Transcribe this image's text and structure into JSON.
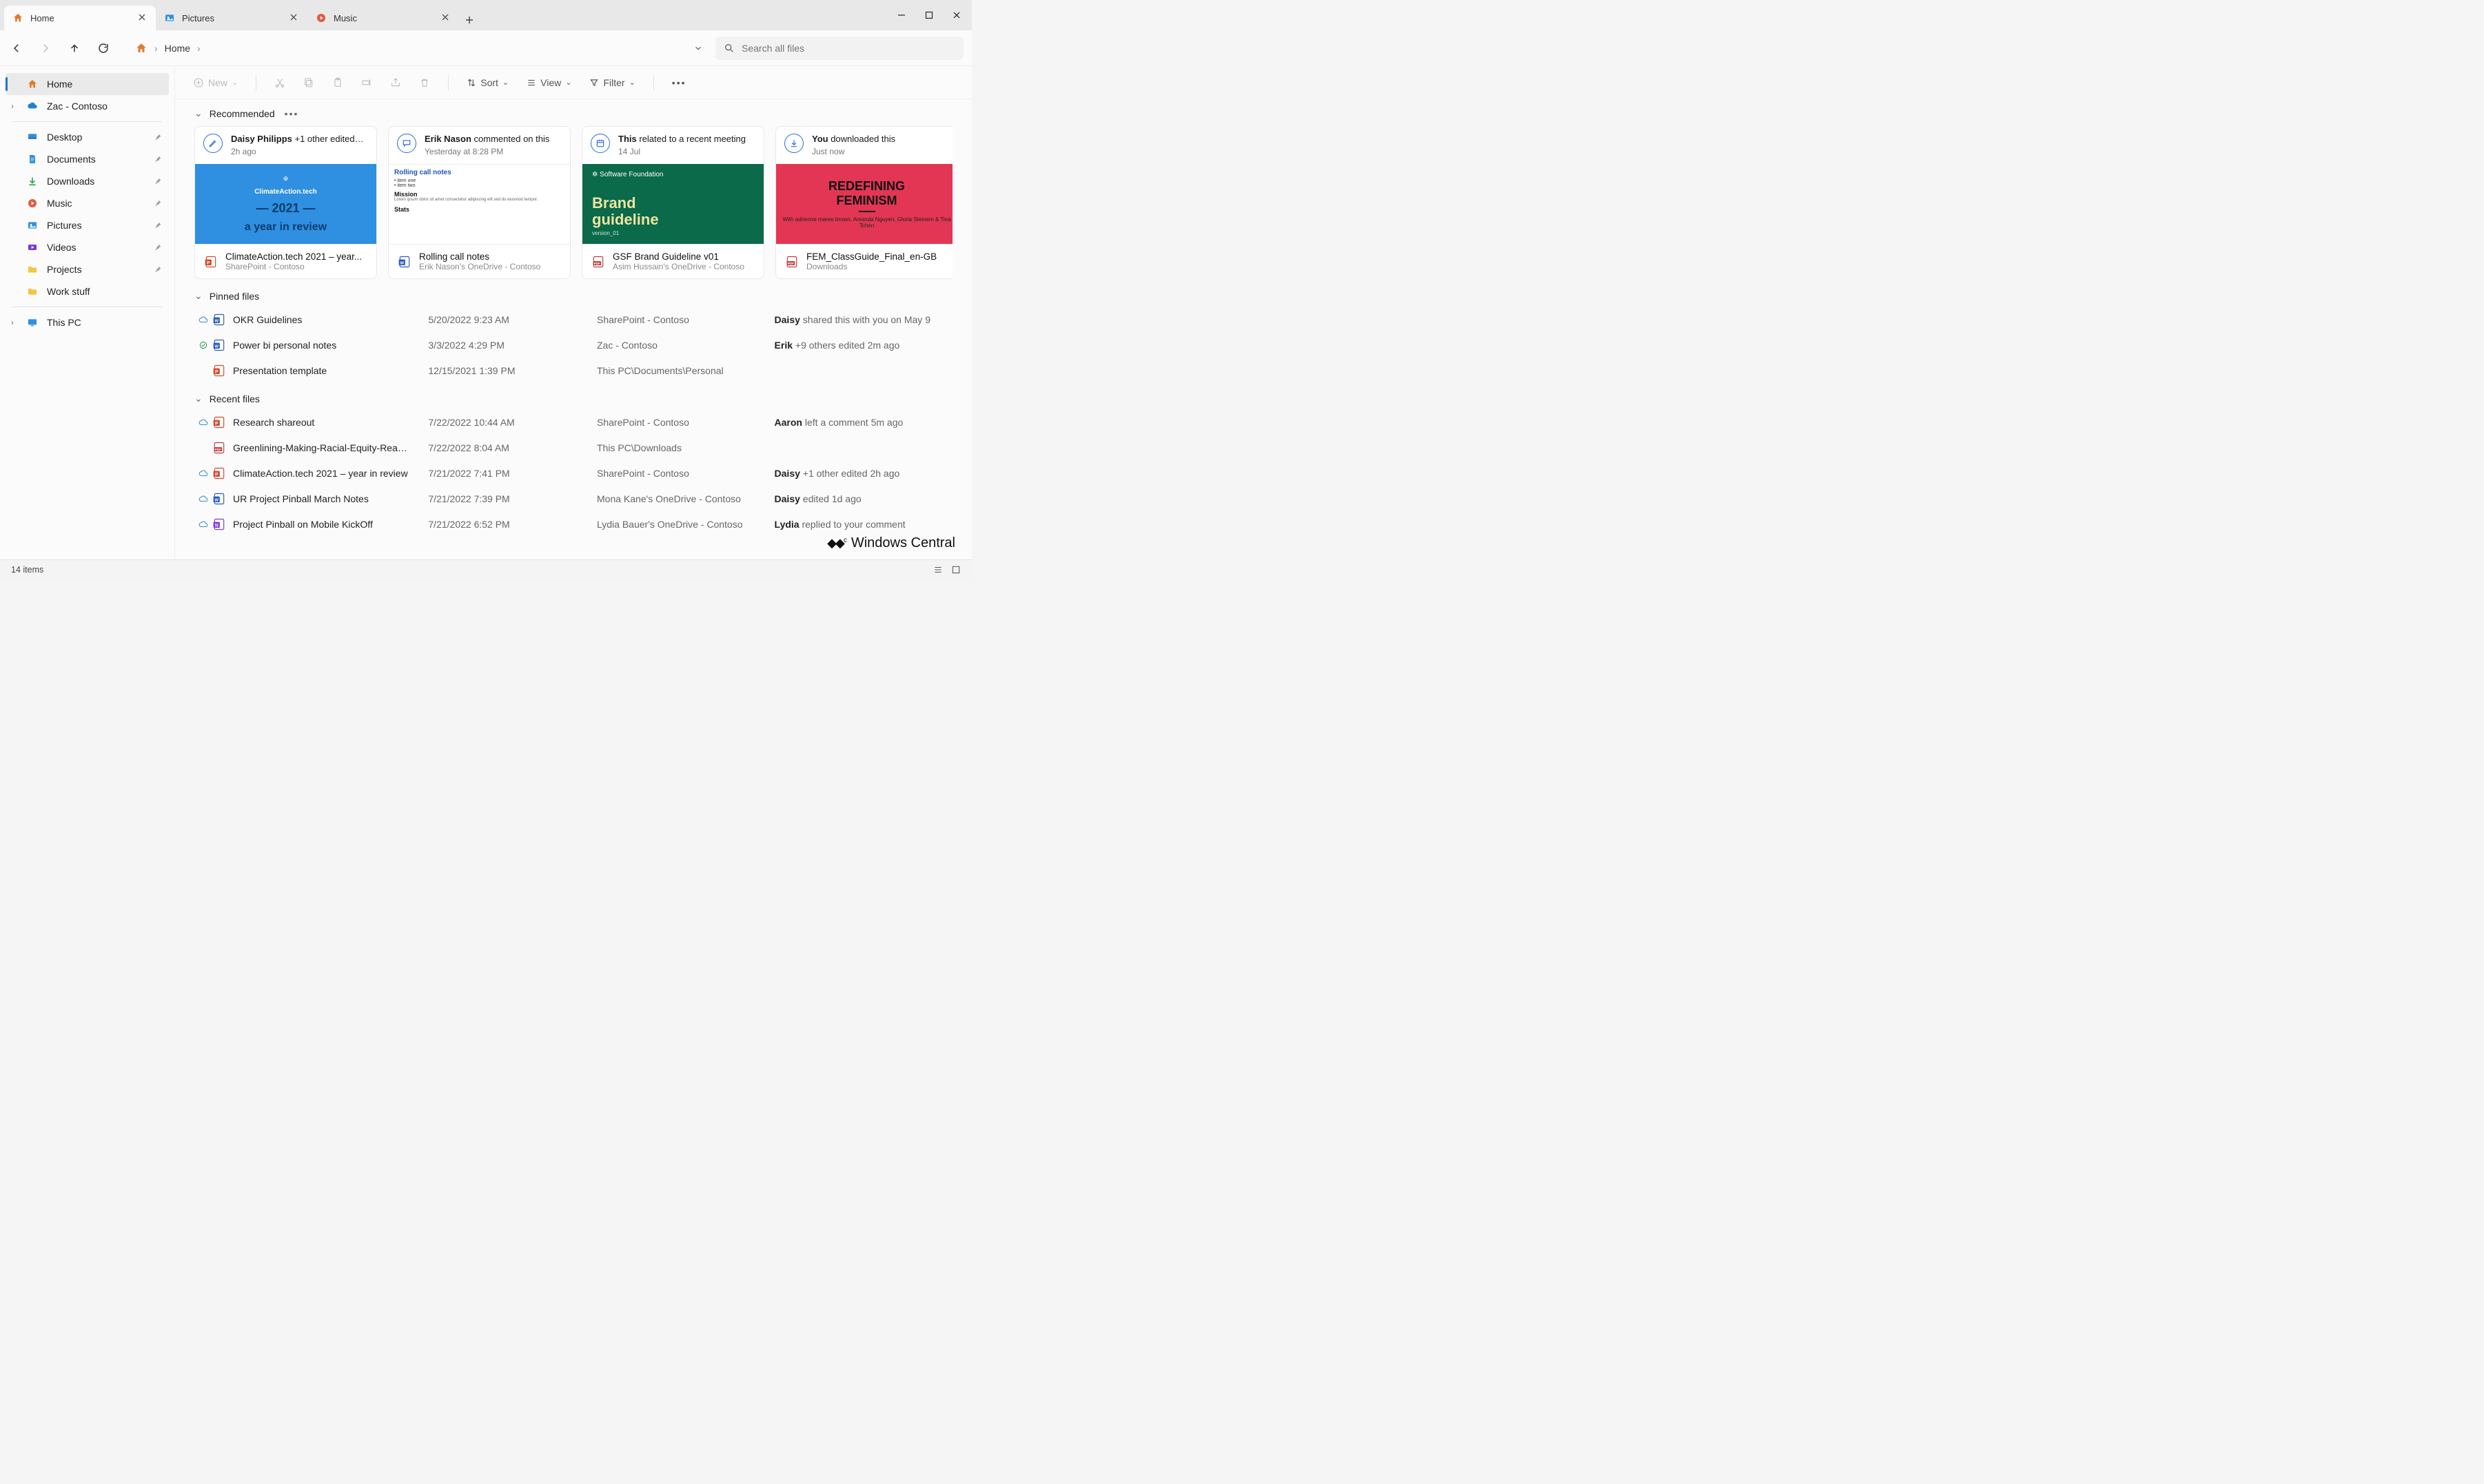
{
  "window": {
    "tabs": [
      {
        "label": "Home",
        "icon": "home"
      },
      {
        "label": "Pictures",
        "icon": "pictures"
      },
      {
        "label": "Music",
        "icon": "music"
      }
    ],
    "active_tab": 0
  },
  "nav": {
    "breadcrumb": "Home",
    "search_placeholder": "Search all files"
  },
  "sidebar": {
    "top": [
      {
        "label": "Home",
        "icon": "home",
        "selected": true
      },
      {
        "label": "Zac - Contoso",
        "icon": "onedrive",
        "expandable": true
      }
    ],
    "quick": [
      {
        "label": "Desktop",
        "icon": "desktop",
        "pinned": true
      },
      {
        "label": "Documents",
        "icon": "documents",
        "pinned": true
      },
      {
        "label": "Downloads",
        "icon": "downloads",
        "pinned": true
      },
      {
        "label": "Music",
        "icon": "music",
        "pinned": true
      },
      {
        "label": "Pictures",
        "icon": "pictures",
        "pinned": true
      },
      {
        "label": "Videos",
        "icon": "videos",
        "pinned": true
      },
      {
        "label": "Projects",
        "icon": "folder",
        "pinned": true
      },
      {
        "label": "Work stuff",
        "icon": "folder",
        "pinned": false
      }
    ],
    "bottom": [
      {
        "label": "This PC",
        "icon": "thispc",
        "expandable": true
      }
    ]
  },
  "cmdbar": {
    "new": "New",
    "sort": "Sort",
    "view": "View",
    "filter": "Filter"
  },
  "recommended": {
    "heading": "Recommended",
    "cards": [
      {
        "action_bold": "Daisy Philipps",
        "action_rest": " +1 other edited…",
        "sub": "2h ago",
        "icon": "edit",
        "thumb": "blue",
        "thumb_lines": [
          "ClimateAction.tech",
          "— 2021 —",
          "a year in review"
        ],
        "file_kind": "ppt",
        "filename": "ClimateAction.tech 2021 – year...",
        "location": "SharePoint - Contoso"
      },
      {
        "action_bold": "Erik Nason",
        "action_rest": " commented on this",
        "sub": "Yesterday at 8:28 PM",
        "icon": "comment",
        "thumb": "doc",
        "thumb_title": "Rolling call notes",
        "file_kind": "word",
        "filename": "Rolling call notes",
        "location": "Erik Nason's OneDrive - Contoso"
      },
      {
        "action_bold": "This",
        "action_rest": " related to a recent meeting",
        "sub": "14 Jul",
        "icon": "calendar",
        "thumb": "green",
        "thumb_tag": "Software Foundation",
        "thumb_lines": [
          "Brand",
          "guideline"
        ],
        "thumb_footer": "version_01",
        "file_kind": "pdf",
        "filename": "GSF Brand Guideline v01",
        "location": "Asim Hussain's OneDrive - Contoso"
      },
      {
        "action_bold": "You",
        "action_rest": " downloaded this",
        "sub": "Just now",
        "icon": "download",
        "thumb": "red",
        "thumb_lines": [
          "REDEFINING",
          "FEMINISM"
        ],
        "thumb_small": "With adrienne maree brown, Amanda Nguyen, Gloria Steinem & Tina Tchen",
        "file_kind": "pdf",
        "filename": "FEM_ClassGuide_Final_en-GB",
        "location": "Downloads"
      }
    ]
  },
  "pinned": {
    "heading": "Pinned files",
    "rows": [
      {
        "status": "cloud",
        "kind": "word",
        "name": "OKR Guidelines",
        "date": "5/20/2022 9:23 AM",
        "loc": "SharePoint - Contoso",
        "act_bold": "Daisy",
        "act_rest": " shared this with you on May 9"
      },
      {
        "status": "sync",
        "kind": "word",
        "name": "Power bi personal notes",
        "date": "3/3/2022 4:29 PM",
        "loc": "Zac - Contoso",
        "act_bold": "Erik",
        "act_rest": " +9 others edited 2m ago"
      },
      {
        "status": "",
        "kind": "ppt",
        "name": "Presentation template",
        "date": "12/15/2021 1:39 PM",
        "loc": "This PC\\Documents\\Personal",
        "act_bold": "",
        "act_rest": ""
      }
    ]
  },
  "recent": {
    "heading": "Recent files",
    "rows": [
      {
        "status": "cloud",
        "kind": "ppt",
        "name": "Research shareout",
        "date": "7/22/2022 10:44 AM",
        "loc": "SharePoint - Contoso",
        "act_bold": "Aaron",
        "act_rest": " left a comment 5m ago"
      },
      {
        "status": "",
        "kind": "pdf",
        "name": "Greenlining-Making-Racial-Equity-Rea…",
        "date": "7/22/2022 8:04 AM",
        "loc": "This PC\\Downloads",
        "act_bold": "",
        "act_rest": ""
      },
      {
        "status": "cloud",
        "kind": "ppt",
        "name": "ClimateAction.tech 2021 – year in review",
        "date": "7/21/2022 7:41 PM",
        "loc": "SharePoint - Contoso",
        "act_bold": "Daisy",
        "act_rest": " +1 other edited 2h ago"
      },
      {
        "status": "cloud",
        "kind": "word",
        "name": "UR Project Pinball March Notes",
        "date": "7/21/2022 7:39 PM",
        "loc": "Mona Kane's OneDrive - Contoso",
        "act_bold": "Daisy",
        "act_rest": " edited 1d ago"
      },
      {
        "status": "cloud",
        "kind": "onenote",
        "name": "Project Pinball on Mobile KickOff",
        "date": "7/21/2022 6:52 PM",
        "loc": "Lydia Bauer's OneDrive - Contoso",
        "act_bold": "Lydia",
        "act_rest": " replied to your comment"
      }
    ]
  },
  "status": {
    "items": "14 items"
  },
  "watermark": "Windows Central"
}
